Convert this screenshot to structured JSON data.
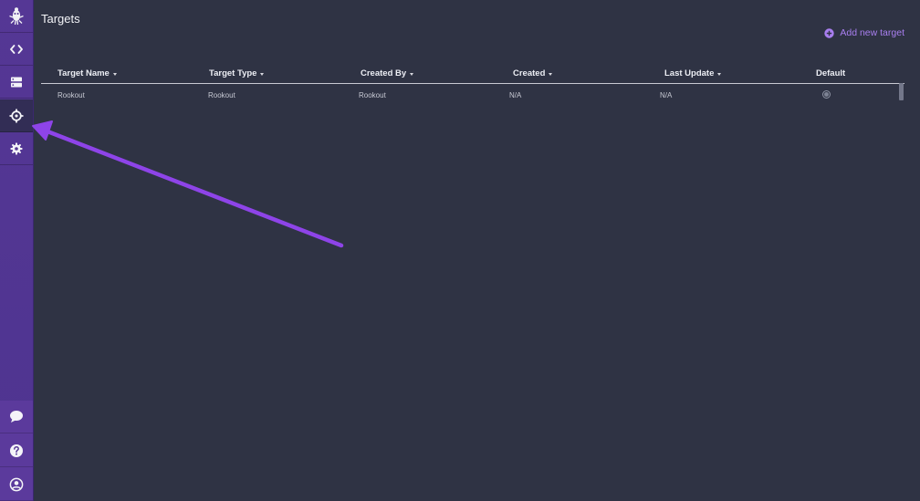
{
  "page": {
    "title": "Targets",
    "add_button_label": "Add new target"
  },
  "sidebar": {
    "top_items": [
      {
        "name": "rookout-logo-icon"
      },
      {
        "name": "code-icon"
      },
      {
        "name": "server-icon"
      },
      {
        "name": "target-icon",
        "active": true
      },
      {
        "name": "gear-icon"
      }
    ],
    "bottom_items": [
      {
        "name": "chat-bubble-icon"
      },
      {
        "name": "help-icon"
      },
      {
        "name": "user-icon"
      }
    ]
  },
  "table": {
    "columns": [
      "Target Name",
      "Target Type",
      "Created By",
      "Created",
      "Last Update",
      "Default"
    ],
    "rows": [
      {
        "target_name": "Rookout",
        "target_type": "Rookout",
        "created_by": "Rookout",
        "created": "N/A",
        "last_update": "N/A",
        "default": true
      }
    ]
  },
  "colors": {
    "background": "#2f3344",
    "sidebar": "#553795",
    "accent": "#a97ff0",
    "annotation_arrow": "#8e44e8"
  }
}
